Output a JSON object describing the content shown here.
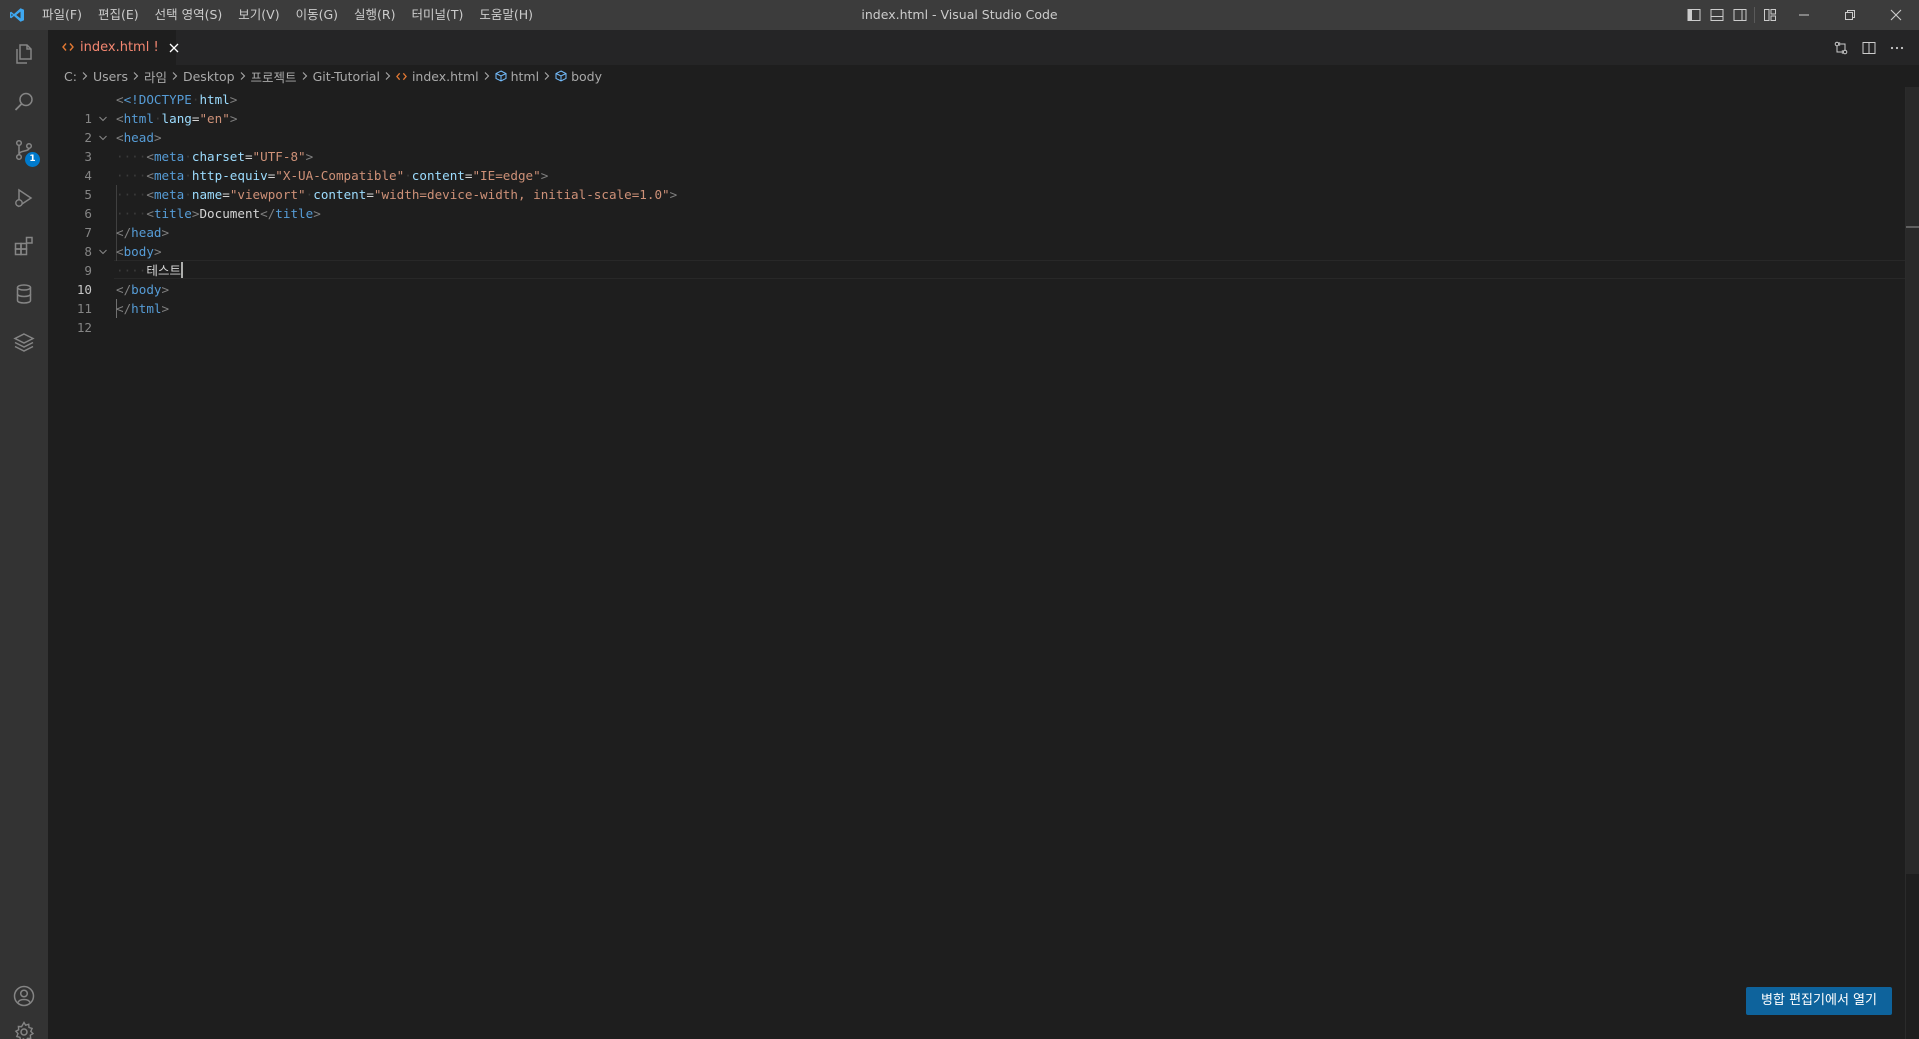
{
  "window": {
    "title": "index.html - Visual Studio Code",
    "menu": [
      "파일(F)",
      "편집(E)",
      "선택 영역(S)",
      "보기(V)",
      "이동(G)",
      "실행(R)",
      "터미널(T)",
      "도움말(H)"
    ]
  },
  "activity_bar": {
    "items": [
      "explorer-icon",
      "search-icon",
      "source-control-icon",
      "run-debug-icon",
      "extensions-icon",
      "database-icon",
      "layers-icon"
    ],
    "bottom": [
      "account-icon",
      "settings-gear-icon"
    ],
    "source_control_badge": "1"
  },
  "tab": {
    "label": "index.html",
    "modified_marker": "!"
  },
  "breadcrumb": [
    "C:",
    "Users",
    "라임",
    "Desktop",
    "프로젝트",
    "Git-Tutorial",
    "index.html",
    "html",
    "body"
  ],
  "editor": {
    "active_line": "10",
    "lines": [
      {
        "n": "1"
      },
      {
        "n": "2"
      },
      {
        "n": "3"
      },
      {
        "n": "4"
      },
      {
        "n": "5"
      },
      {
        "n": "6"
      },
      {
        "n": "7"
      },
      {
        "n": "8"
      },
      {
        "n": "9"
      },
      {
        "n": "10"
      },
      {
        "n": "11"
      },
      {
        "n": "12"
      }
    ],
    "code": {
      "l1_doctype": "<!DOCTYPE",
      "l1_html": "html",
      "l2_tag": "html",
      "l2_attr": "lang",
      "l2_val": "\"en\"",
      "l3_tag": "head",
      "l4_tag": "meta",
      "l4_attr": "charset",
      "l4_val": "\"UTF-8\"",
      "l5_tag": "meta",
      "l5_attr1": "http-equiv",
      "l5_val1": "\"X-UA-Compatible\"",
      "l5_attr2": "content",
      "l5_val2": "\"IE=edge\"",
      "l6_tag": "meta",
      "l6_attr1": "name",
      "l6_val1": "\"viewport\"",
      "l6_attr2": "content",
      "l6_val2": "\"width=device-width, initial-scale=1.0\"",
      "l7_tag": "title",
      "l7_text": "Document",
      "l8_tag": "head",
      "l9_tag": "body",
      "l10_text": "테스트",
      "l11_tag": "body",
      "l12_tag": "html"
    }
  },
  "merge_button": {
    "label": "병합 편집기에서 열기"
  },
  "colors": {
    "accent": "#007acc",
    "button": "#0e639c",
    "modified_tab": "#f48771"
  }
}
